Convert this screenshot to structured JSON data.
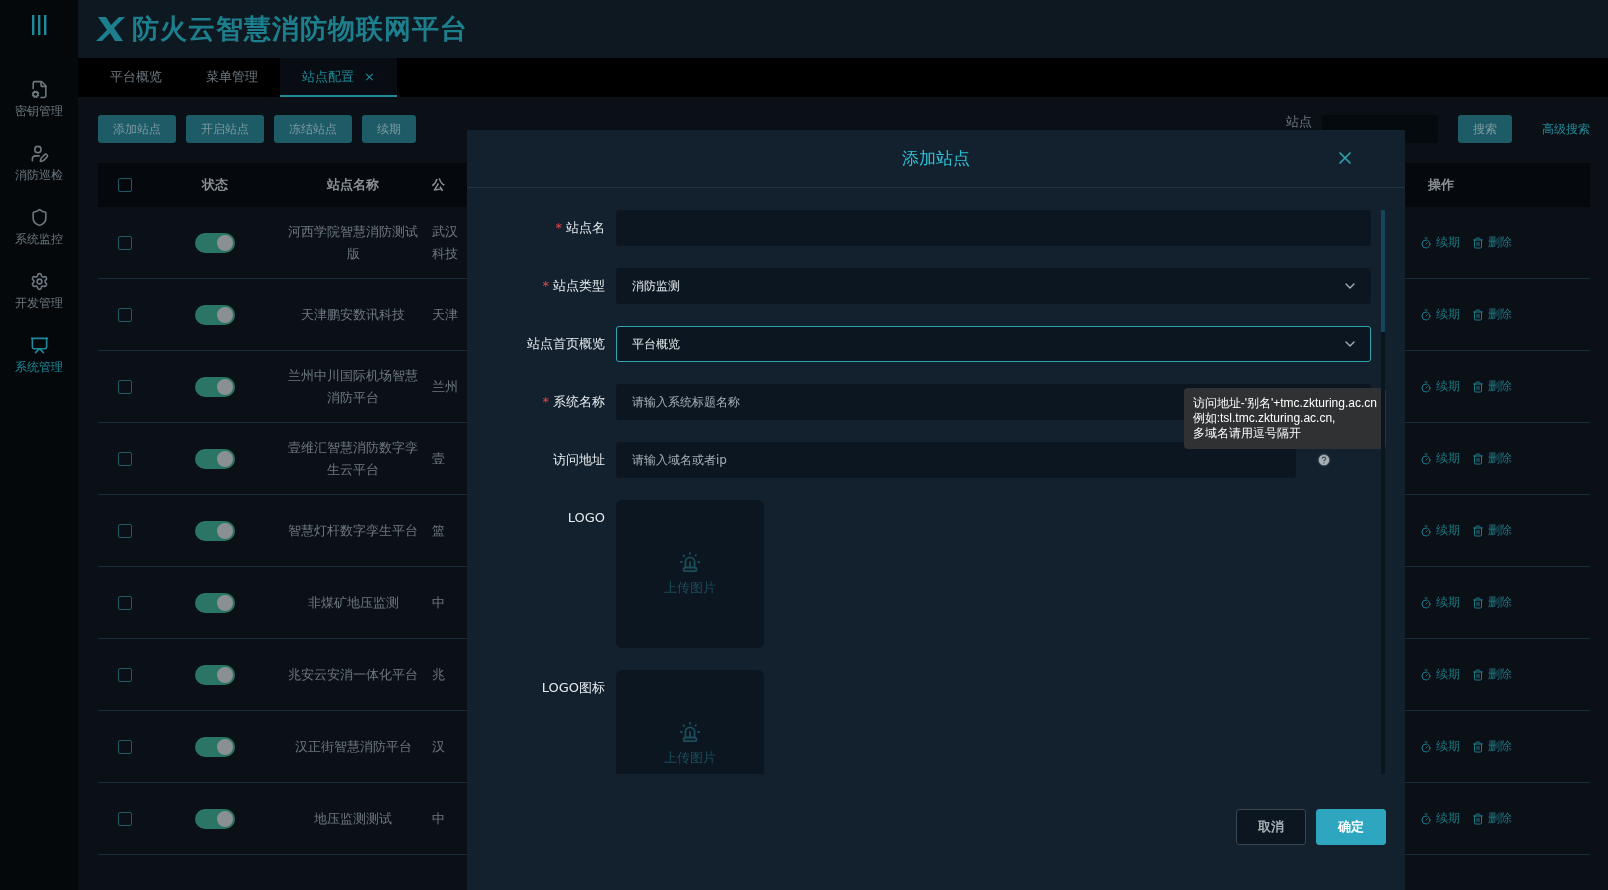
{
  "header": {
    "title": "防火云智慧消防物联网平台"
  },
  "sidebar": {
    "items": [
      {
        "label": "密钥管理",
        "selected": false
      },
      {
        "label": "消防巡检",
        "selected": false
      },
      {
        "label": "系统监控",
        "selected": false
      },
      {
        "label": "开发管理",
        "selected": false
      },
      {
        "label": "系统管理",
        "selected": true
      }
    ]
  },
  "tabs": [
    {
      "label": "平台概览",
      "selected": false
    },
    {
      "label": "菜单管理",
      "selected": false
    },
    {
      "label": "站点配置",
      "selected": true,
      "close": "×"
    }
  ],
  "toolbar": {
    "buttons": [
      "添加站点",
      "开启站点",
      "冻结站点",
      "续期"
    ],
    "search_label": "站点",
    "search_button": "搜索",
    "advanced_search": "高级搜索"
  },
  "table": {
    "all_checked": false,
    "columns": [
      "状态",
      "站点名称",
      "公"
    ],
    "action_column": "操作",
    "rows": [
      {
        "checked": false,
        "enabled": true,
        "name": "河西学院智慧消防测试版",
        "column_4": "武汉科技",
        "actions": [
          "续期",
          "删除"
        ]
      },
      {
        "checked": false,
        "enabled": true,
        "name": "天津鹏安数讯科技",
        "column_4": "天津",
        "actions": [
          "续期",
          "删除"
        ]
      },
      {
        "checked": false,
        "enabled": true,
        "name": "兰州中川国际机场智慧消防平台",
        "column_4": "兰州",
        "actions": [
          "续期",
          "删除"
        ]
      },
      {
        "checked": false,
        "enabled": true,
        "name": "壹维汇智慧消防数字孪生云平台",
        "column_4": "壹",
        "actions": [
          "续期",
          "删除"
        ]
      },
      {
        "checked": false,
        "enabled": true,
        "name": "智慧灯杆数字孪生平台",
        "column_4": "篮",
        "actions": [
          "续期",
          "删除"
        ]
      },
      {
        "checked": false,
        "enabled": true,
        "name": "非煤矿地压监测",
        "column_4": "中",
        "actions": [
          "续期",
          "删除"
        ]
      },
      {
        "checked": false,
        "enabled": true,
        "name": "兆安云安消一体化平台",
        "column_4": "兆",
        "actions": [
          "续期",
          "删除"
        ]
      },
      {
        "checked": false,
        "enabled": true,
        "name": "汉正街智慧消防平台",
        "column_4": "汉",
        "actions": [
          "续期",
          "删除"
        ]
      },
      {
        "checked": false,
        "enabled": true,
        "name": "地压监测测试",
        "column_4": "中",
        "actions": [
          "续期",
          "删除"
        ]
      }
    ]
  },
  "dialog": {
    "title": "添加站点",
    "required_mark": "*",
    "fields": [
      {
        "kind": "input",
        "label": "站点名",
        "required": true,
        "focused": false
      },
      {
        "kind": "select",
        "label": "站点类型",
        "required": true,
        "value": "消防监测",
        "focused": false
      },
      {
        "kind": "select",
        "label": "站点首页概览",
        "required": false,
        "value": "平台概览",
        "focused": true
      },
      {
        "kind": "input",
        "label": "系统名称",
        "required": true,
        "placeholder": "请输入系统标题名称",
        "focused": false
      },
      {
        "kind": "input",
        "label": "访问地址",
        "required": false,
        "placeholder": "请输入域名或者ip",
        "focused": false,
        "help": true
      },
      {
        "kind": "upload",
        "label": "LOGO",
        "text": "上传图片"
      },
      {
        "kind": "upload",
        "label": "LOGO图标",
        "text": "上传图片"
      }
    ],
    "tooltip": "访问地址-'别名'+tmc.zkturing.ac.cn\n例如:tsl.tmc.zkturing.ac.cn,\n多域名请用逗号隔开",
    "buttons": [
      {
        "label": "取消",
        "kind": "secondary"
      },
      {
        "label": "确定",
        "kind": "primary"
      }
    ]
  }
}
